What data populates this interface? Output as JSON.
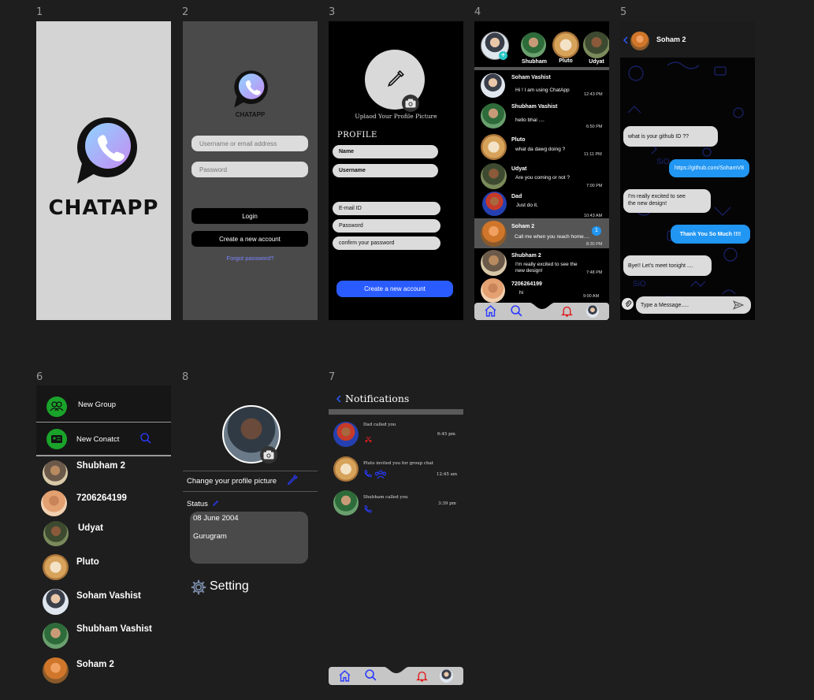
{
  "frame_numbers": {
    "f1": "1",
    "f2": "2",
    "f3": "3",
    "f4": "4",
    "f5": "5",
    "f6": "6",
    "f8": "8",
    "f7": "7"
  },
  "splash": {
    "app_name": "CHATAPP"
  },
  "login": {
    "app_name": "CHATAPP",
    "username_placeholder": "Username or email address",
    "password_placeholder": "Password",
    "login_label": "Login",
    "create_label": "Create a new account",
    "forgot_label": "Forgot password?"
  },
  "signup": {
    "upload_label": "Uplaod Your Profile Picture",
    "profile_heading": "PROFILE",
    "name_label": "Name",
    "username_label": "Username",
    "email_label": "E-mail ID",
    "password_label": "Password",
    "confirm_label": "confirm your password",
    "create_label": "Create a new account"
  },
  "chat_list": {
    "stories": [
      {
        "name": "Shubham"
      },
      {
        "name": "Pluto"
      },
      {
        "name": "Udyat"
      }
    ],
    "chats": [
      {
        "name": "Soham Vashist",
        "message": "Hi ! I am using ChatApp",
        "time": "12:43 PM"
      },
      {
        "name": "Shubham Vashist",
        "message": "hello bhai ....",
        "time": "6:50 PM"
      },
      {
        "name": "Pluto",
        "message": "what da dawg doing ?",
        "time": "11:11 PM"
      },
      {
        "name": "Udyat",
        "message": "Are you coming or not ?",
        "time": "7:00 PM"
      },
      {
        "name": "Dad",
        "message": "Just do it.",
        "time": "10:43 AM"
      },
      {
        "name": "Soham 2",
        "message": "Call me when you reach home....",
        "time": "8:30 PM",
        "badge": "1"
      },
      {
        "name": "Shubham 2",
        "message": "I'm really excited to see the",
        "message2": "new design!",
        "time": "7:48 PM"
      },
      {
        "name": "7206264199",
        "message": "hi",
        "time": "9:00 AM"
      }
    ]
  },
  "conversation": {
    "contact": "Soham 2",
    "messages": [
      {
        "side": "left",
        "text": "what is your github ID ??"
      },
      {
        "side": "right",
        "text": "https://github.com/SohamV8"
      },
      {
        "side": "left",
        "text": "I'm really excited to see",
        "text2": "the new design!"
      },
      {
        "side": "right",
        "text": "Thank You So Much !!!!"
      },
      {
        "side": "left",
        "text": "Bye!! Let's meet tonight ...."
      }
    ],
    "input_placeholder": "Type a Message....."
  },
  "contacts": {
    "new_group": "New Group",
    "new_contact": "New Conatct",
    "list": [
      "Shubham 2",
      "7206264199",
      "Udyat",
      "Pluto",
      "Soham Vashist",
      "Shubham Vashist",
      "Soham 2"
    ]
  },
  "profile": {
    "change_picture": "Change your profile picture",
    "status_label": "Status",
    "status_line1": "08 June 2004",
    "status_line2": "Gurugram",
    "setting_label": "Setting"
  },
  "notifications": {
    "title": "Notifications",
    "items": [
      {
        "text": "Dad called you",
        "time": "6:45 pm"
      },
      {
        "text": "Pluto invited you for group chat",
        "time": "12:45 am"
      },
      {
        "text": "Shubham called you",
        "time": "3:39 pm"
      }
    ]
  },
  "colors": {
    "accent_blue": "#2a5bff",
    "bubble_blue": "#2196f3",
    "bell_red": "#e11d1d",
    "green": "#1aa32a"
  }
}
